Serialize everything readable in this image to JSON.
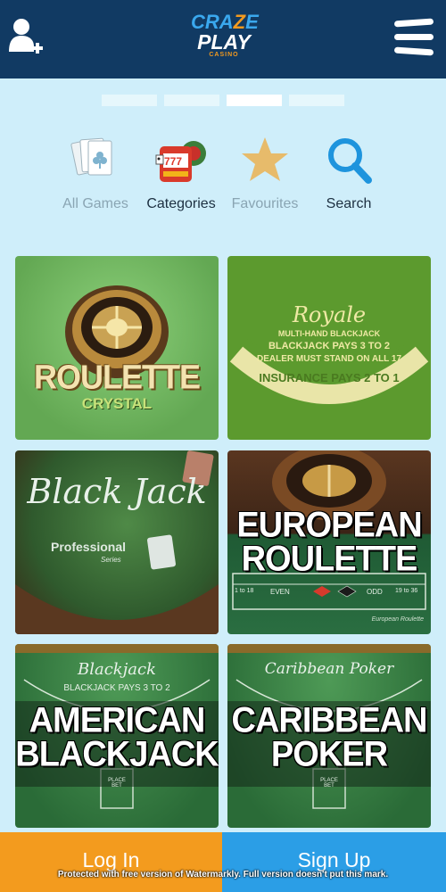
{
  "header": {
    "logo": {
      "line1_a": "CRA",
      "line1_z": "Z",
      "line1_b": "E",
      "line2": "PLAY",
      "line3": "CASINO"
    },
    "user_icon": "user-add-icon",
    "menu_icon": "hamburger-menu-icon"
  },
  "carousel": {
    "pages": 4,
    "active_index": 2
  },
  "categories": [
    {
      "label": "All Games",
      "icon": "playing-cards-icon"
    },
    {
      "label": "Categories",
      "icon": "slot-machine-icon"
    },
    {
      "label": "Favourites",
      "icon": "star-icon"
    },
    {
      "label": "Search",
      "icon": "search-icon"
    }
  ],
  "games": [
    {
      "title_line1": "ROULETTE",
      "title_line2": "CRYSTAL"
    },
    {
      "script": "Royale",
      "lines": [
        "MULTI-HAND BLACKJACK",
        "BLACKJACK PAYS 3 TO 2",
        "DEALER MUST STAND ON ALL 17",
        "INSURANCE PAYS 2 TO 1"
      ]
    },
    {
      "script": "Black Jack",
      "sub": "Professional",
      "sub2": "Series"
    },
    {
      "title_line1": "EUROPEAN",
      "title_line2": "ROULETTE",
      "table_labels": [
        "1 to 18",
        "EVEN",
        "ODD",
        "19 to 36"
      ],
      "caption": "European Roulette"
    },
    {
      "script": "Blackjack",
      "arc": "BLACKJACK PAYS 3 TO 2",
      "title_line1": "AMERICAN",
      "title_line2": "BLACKJACK",
      "place_bet": "PLACE BET"
    },
    {
      "script": "Caribbean Poker",
      "title_line1": "CARIBBEAN",
      "title_line2": "POKER",
      "place_bet": "PLACE BET"
    }
  ],
  "footer": {
    "login_label": "Log In",
    "signup_label": "Sign Up",
    "watermark": "Protected with free version of Watermarkly. Full version doesn't put this mark."
  },
  "colors": {
    "header_bg": "#113a63",
    "page_bg": "#cfeefa",
    "login_bg": "#f39b1e",
    "signup_bg": "#2b9ee6"
  }
}
